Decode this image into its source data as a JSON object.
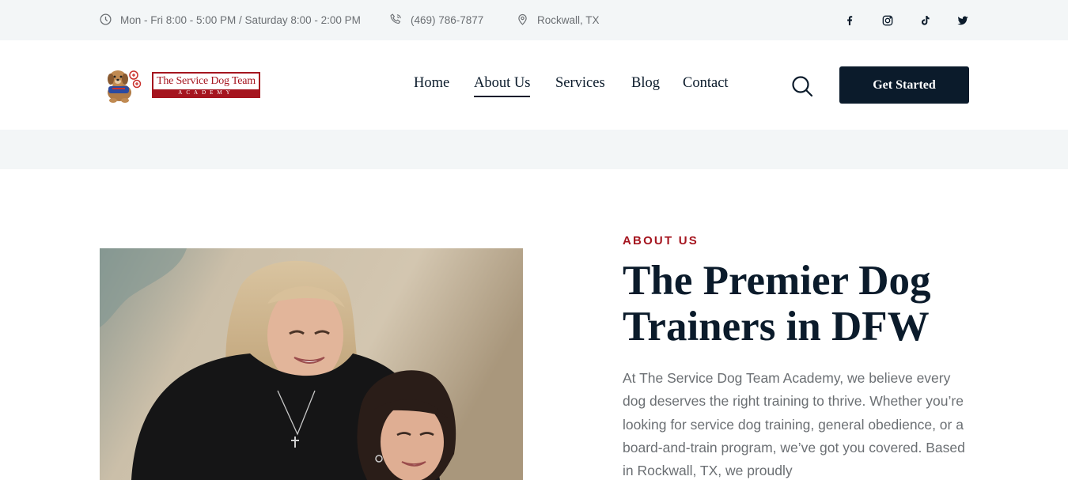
{
  "topbar": {
    "hours": "Mon - Fri 8:00 - 5:00 PM / Saturday 8:00 - 2:00 PM",
    "phone": "(469) 786-7877",
    "location": "Rockwall, TX",
    "icons": [
      "clock-icon",
      "phone-icon",
      "map-pin-icon"
    ],
    "social": [
      "facebook-icon",
      "instagram-icon",
      "tiktok-icon",
      "twitter-icon"
    ]
  },
  "logo": {
    "title": "The Service Dog Team",
    "subtitle": "ACADEMY"
  },
  "nav": {
    "items": [
      {
        "label": "Home",
        "active": false
      },
      {
        "label": "About Us",
        "active": true
      },
      {
        "label": "Services",
        "active": false
      },
      {
        "label": "Blog",
        "active": false
      },
      {
        "label": "Contact",
        "active": false
      }
    ],
    "search_icon": "search-icon",
    "cta_label": "Get Started"
  },
  "hero": {
    "eyebrow": "ABOUT US",
    "headline": "The Premier Dog Trainers in DFW",
    "body": "At The Service Dog Team Academy, we believe every dog deserves the right training to thrive. Whether you’re looking for service dog training, general obedience, or a board-and-train program, we’ve got you covered. Based in Rockwall, TX, we proudly"
  },
  "colors": {
    "navy": "#0b1b2b",
    "accent_red": "#a5151f",
    "topbar_bg": "#f3f6f7",
    "muted_text": "#6b6f73"
  }
}
